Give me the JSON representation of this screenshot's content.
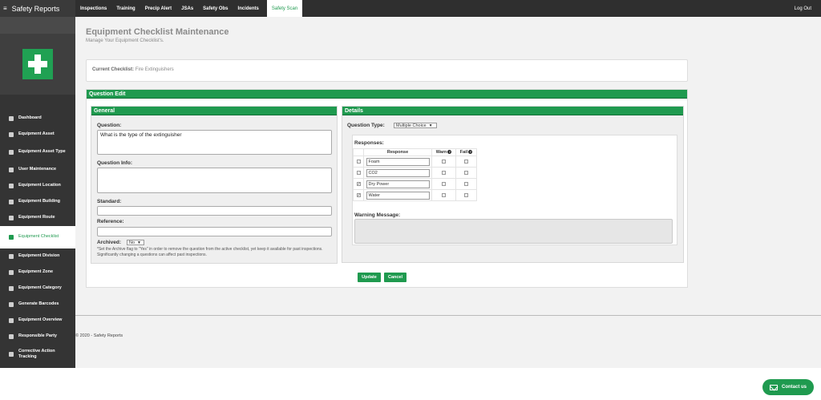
{
  "app": {
    "title": "Safety Reports",
    "menu_glyph": "≡"
  },
  "topnav": {
    "items": [
      "Inspections",
      "Training",
      "Precip Alert",
      "JSAs",
      "Safety Obs",
      "Incidents",
      "Safety Scan"
    ],
    "active": "Safety Scan",
    "logout": "Log Out"
  },
  "sidebar": {
    "items": [
      "Dashboard",
      "Equipment Asset",
      "Equipment Asset Type",
      "User Maintenance",
      "Equipment Location",
      "Equipment Building",
      "Equipment Route",
      "Equipment Checklist",
      "Equipment Division",
      "Equipment Zone",
      "Equipment Category",
      "Generate Barcodes",
      "Equipment Overview",
      "Responsible Party",
      "Corrective Action Tracking"
    ],
    "active": "Equipment Checklist"
  },
  "page": {
    "title": "Equipment Checklist Maintenance",
    "subtitle": "Manage Your Equipment Checklist's.",
    "current_label": "Current Checklist:",
    "current_value": "Fire Extinguishers"
  },
  "question_edit": {
    "header": "Question Edit",
    "general": {
      "header": "General",
      "question_label": "Question:",
      "question_value": "What is the type of the extinguisher",
      "info_label": "Question Info:",
      "info_value": "",
      "standard_label": "Standard:",
      "reference_label": "Reference:",
      "archived_label": "Archived:",
      "archived_value": "No",
      "archived_note": "*Set the Archive flag to \"Yes\" in order to remove the question from the active checklist, yet keep it available for past inspections. Significantly changing a questions can affect past inspections."
    },
    "details": {
      "header": "Details",
      "type_label": "Question Type:",
      "type_value": "Multiple Choice",
      "responses_label": "Responses:",
      "columns": {
        "response": "Response",
        "warn": "Warn",
        "fail": "Fail"
      },
      "responses": [
        {
          "selected": true,
          "faded": true,
          "value": "Foam"
        },
        {
          "selected": true,
          "faded": true,
          "value": "CO2"
        },
        {
          "selected": true,
          "faded": false,
          "value": "Dry Power"
        },
        {
          "selected": true,
          "faded": false,
          "value": "Water"
        }
      ],
      "warning_label": "Warning Message:"
    },
    "buttons": {
      "update": "Update",
      "cancel": "Cancel"
    }
  },
  "footer": {
    "copyright": "© 2020 - Safety Reports"
  },
  "contact": {
    "label": "Contact us"
  }
}
